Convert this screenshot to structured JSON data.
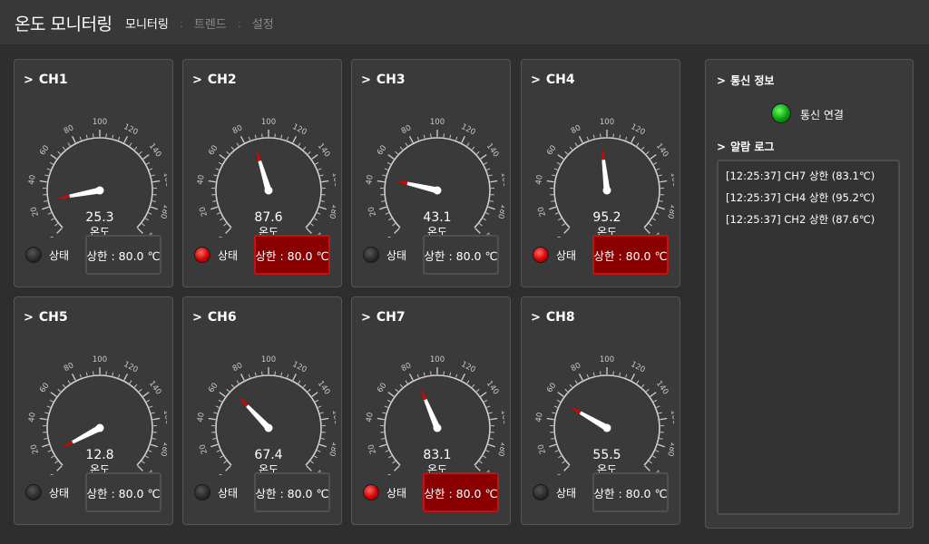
{
  "app": {
    "title": "온도 모니터링",
    "tabs": [
      {
        "label": "모니터링",
        "active": true
      },
      {
        "label": "트렌드",
        "active": false
      },
      {
        "label": "설정",
        "active": false
      }
    ],
    "separator": ":"
  },
  "gauge_scale": {
    "min": 0,
    "max": 200,
    "tick_labels": [
      "0",
      "20",
      "40",
      "60",
      "80",
      "100",
      "120",
      "140",
      "160",
      "180",
      "200"
    ],
    "unit_label": "온도"
  },
  "channels": [
    {
      "name": "CH1",
      "value": "25.3",
      "status_label": "상태",
      "limit_text": "상한 : 80.0 ℃",
      "alarm": false
    },
    {
      "name": "CH2",
      "value": "87.6",
      "status_label": "상태",
      "limit_text": "상한 : 80.0 ℃",
      "alarm": true
    },
    {
      "name": "CH3",
      "value": "43.1",
      "status_label": "상태",
      "limit_text": "상한 : 80.0 ℃",
      "alarm": false
    },
    {
      "name": "CH4",
      "value": "95.2",
      "status_label": "상태",
      "limit_text": "상한 : 80.0 ℃",
      "alarm": true
    },
    {
      "name": "CH5",
      "value": "12.8",
      "status_label": "상태",
      "limit_text": "상한 : 80.0 ℃",
      "alarm": false
    },
    {
      "name": "CH6",
      "value": "67.4",
      "status_label": "상태",
      "limit_text": "상한 : 80.0 ℃",
      "alarm": false
    },
    {
      "name": "CH7",
      "value": "83.1",
      "status_label": "상태",
      "limit_text": "상한 : 80.0 ℃",
      "alarm": true
    },
    {
      "name": "CH8",
      "value": "55.5",
      "status_label": "상태",
      "limit_text": "상한 : 80.0 ℃",
      "alarm": false
    }
  ],
  "side": {
    "comm_title": "통신 정보",
    "comm_status": "통신 연결",
    "log_title": "알람 로그",
    "log": [
      "[12:25:37] CH7 상한 (83.1℃)",
      "[12:25:37] CH4 상한 (95.2℃)",
      "[12:25:37] CH2 상한 (87.6℃)"
    ]
  },
  "colors": {
    "background": "#2e2e2e",
    "panel": "#3a3a3a",
    "alarm_red": "#8a0000",
    "needle_tip": "#e00000",
    "comm_green": "#0aa00a"
  }
}
